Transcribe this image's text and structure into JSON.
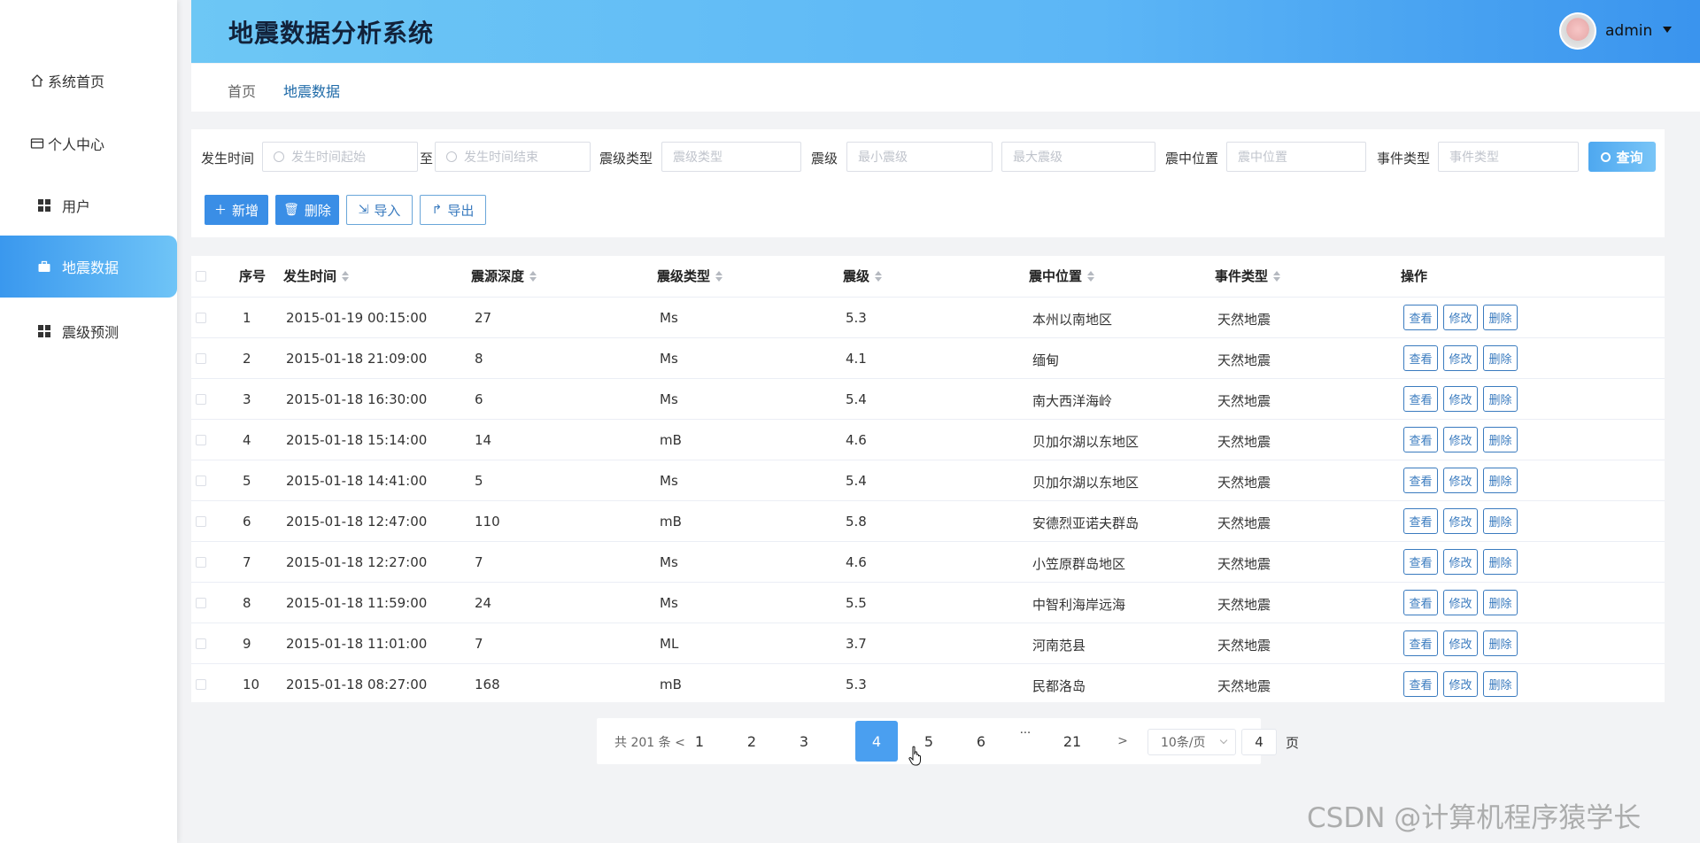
{
  "sidebar": {
    "items": [
      {
        "label": "系统首页",
        "icon": "home-icon"
      },
      {
        "label": "个人中心",
        "icon": "card-icon"
      },
      {
        "label": "用户",
        "icon": "grid-icon"
      },
      {
        "label": "地震数据",
        "icon": "briefcase-icon",
        "active": true
      },
      {
        "label": "震级预测",
        "icon": "grid-icon"
      }
    ]
  },
  "header": {
    "title": "地震数据分析系统",
    "user": "admin",
    "gradient": [
      "#6dc7f5",
      "#3a94ee"
    ]
  },
  "breadcrumb": {
    "home": "首页",
    "current": "地震数据"
  },
  "search": {
    "time_label": "发生时间",
    "time_start_placeholder": "发生时间起始",
    "to_label": "至",
    "time_end_placeholder": "发生时间结束",
    "type_label": "震级类型",
    "type_placeholder": "震级类型",
    "mag_label": "震级",
    "mag_min_placeholder": "最小震级",
    "mag_max_placeholder": "最大震级",
    "loc_label": "震中位置",
    "loc_placeholder": "震中位置",
    "event_label": "事件类型",
    "event_placeholder": "事件类型",
    "query_button": "查询"
  },
  "actions": {
    "add": "新增",
    "delete": "删除",
    "import": "导入",
    "export": "导出"
  },
  "table": {
    "headers": {
      "index": "序号",
      "time": "发生时间",
      "depth": "震源深度",
      "type": "震级类型",
      "mag": "震级",
      "loc": "震中位置",
      "event": "事件类型",
      "ops": "操作"
    },
    "op_labels": {
      "view": "查看",
      "edit": "修改",
      "del": "删除"
    },
    "rows": [
      {
        "index": "1",
        "time": "2015-01-19 00:15:00",
        "depth": "27",
        "type": "Ms",
        "mag": "5.3",
        "loc": "本州以南地区",
        "event": "天然地震"
      },
      {
        "index": "2",
        "time": "2015-01-18 21:09:00",
        "depth": "8",
        "type": "Ms",
        "mag": "4.1",
        "loc": "缅甸",
        "event": "天然地震"
      },
      {
        "index": "3",
        "time": "2015-01-18 16:30:00",
        "depth": "6",
        "type": "Ms",
        "mag": "5.4",
        "loc": "南大西洋海岭",
        "event": "天然地震"
      },
      {
        "index": "4",
        "time": "2015-01-18 15:14:00",
        "depth": "14",
        "type": "mB",
        "mag": "4.6",
        "loc": "贝加尔湖以东地区",
        "event": "天然地震"
      },
      {
        "index": "5",
        "time": "2015-01-18 14:41:00",
        "depth": "5",
        "type": "Ms",
        "mag": "5.4",
        "loc": "贝加尔湖以东地区",
        "event": "天然地震"
      },
      {
        "index": "6",
        "time": "2015-01-18 12:47:00",
        "depth": "110",
        "type": "mB",
        "mag": "5.8",
        "loc": "安德烈亚诺夫群岛",
        "event": "天然地震"
      },
      {
        "index": "7",
        "time": "2015-01-18 12:27:00",
        "depth": "7",
        "type": "Ms",
        "mag": "4.6",
        "loc": "小笠原群岛地区",
        "event": "天然地震"
      },
      {
        "index": "8",
        "time": "2015-01-18 11:59:00",
        "depth": "24",
        "type": "Ms",
        "mag": "5.5",
        "loc": "中智利海岸远海",
        "event": "天然地震"
      },
      {
        "index": "9",
        "time": "2015-01-18 11:01:00",
        "depth": "7",
        "type": "ML",
        "mag": "3.7",
        "loc": "河南范县",
        "event": "天然地震"
      },
      {
        "index": "10",
        "time": "2015-01-18 08:27:00",
        "depth": "168",
        "type": "mB",
        "mag": "5.3",
        "loc": "民都洛岛",
        "event": "天然地震"
      }
    ]
  },
  "pagination": {
    "total": "共 201 条",
    "prev": "<",
    "pages": [
      "1",
      "2",
      "3",
      "4",
      "5",
      "6",
      "···",
      "21"
    ],
    "current": "4",
    "next": ">",
    "page_size": "10条/页",
    "jump_value": "4",
    "jump_unit": "页"
  },
  "watermark": "CSDN @计算机程序猿学长"
}
